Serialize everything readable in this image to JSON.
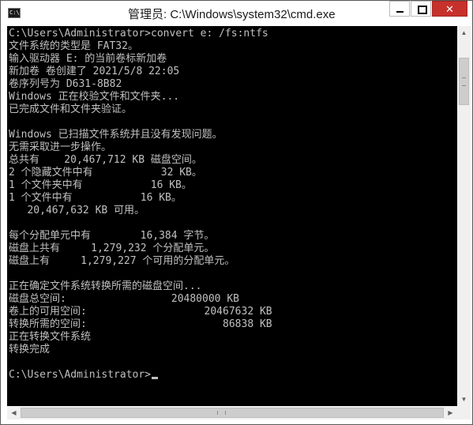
{
  "window": {
    "title": "管理员: C:\\Windows\\system32\\cmd.exe",
    "icon_label": "C:\\",
    "icons": {
      "app": "cmd-icon",
      "minimize": "minimize-icon",
      "maximize": "maximize-icon",
      "close": "close-icon"
    },
    "close_glyph": "✕"
  },
  "console": {
    "lines": [
      "C:\\Users\\Administrator>convert e: /fs:ntfs",
      "文件系统的类型是 FAT32。",
      "输入驱动器 E: 的当前卷标新加卷",
      "新加卷 卷创建了 2021/5/8 22:05",
      "卷序列号为 D631-8B82",
      "Windows 正在校验文件和文件夹...",
      "已完成文件和文件夹验证。",
      "",
      "Windows 已扫描文件系统并且没有发现问题。",
      "无需采取进一步操作。",
      "总共有    20,467,712 KB 磁盘空间。",
      "2 个隐藏文件中有           32 KB。",
      "1 个文件夹中有           16 KB。",
      "1 个文件中有           16 KB。",
      "   20,467,632 KB 可用。",
      "",
      "每个分配单元中有        16,384 字节。",
      "磁盘上共有     1,279,232 个分配单元。",
      "磁盘上有     1,279,227 个可用的分配单元。",
      "",
      "正在确定文件系统转换所需的磁盘空间...",
      "磁盘总空间:                 20480000 KB",
      "卷上的可用空间:                   20467632 KB",
      "转换所需的空间:                      86838 KB",
      "正在转换文件系统",
      "转换完成",
      "",
      "C:\\Users\\Administrator>"
    ],
    "text_color": "#c0c0c0",
    "background_color": "#000000"
  },
  "scrollbars": {
    "vertical": {
      "up_arrow": "▲",
      "down_arrow": "▼"
    },
    "horizontal": {
      "left_arrow": "◀",
      "right_arrow": "▶"
    }
  },
  "colors": {
    "close_button": "#c7312b",
    "titlebar": "#ffffff"
  }
}
